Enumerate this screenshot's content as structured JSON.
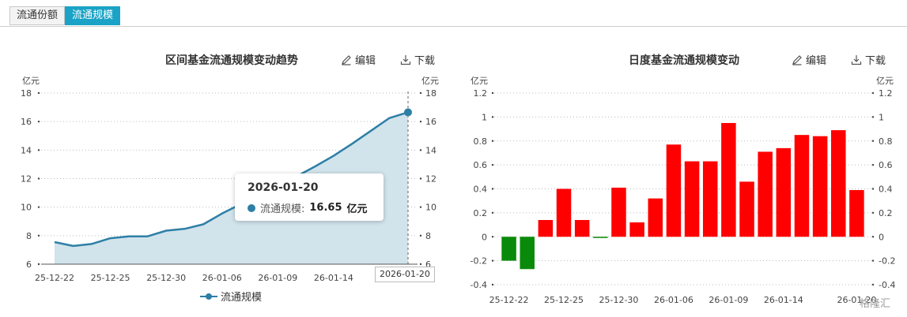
{
  "tabs": [
    {
      "label": "流通份额",
      "active": false
    },
    {
      "label": "流通规模",
      "active": true
    }
  ],
  "toolbar": {
    "edit_label": "编辑",
    "download_label": "下载"
  },
  "colors": {
    "accent": "#1aa3c6",
    "line": "#2e7fa6",
    "area": "#cfe2ea",
    "positive": "#ff0000",
    "negative": "#0a8a0a"
  },
  "watermark": "格隆汇",
  "tooltip": {
    "date": "2026-01-20",
    "series": "流通规模:",
    "value": "16.65",
    "unit": "亿元"
  },
  "chart_data": [
    {
      "type": "area",
      "title": "区间基金流通规模变动趋势",
      "unit_left": "亿元",
      "unit_right": "亿元",
      "ylim": [
        6,
        18
      ],
      "yticks": [
        6,
        8,
        10,
        12,
        14,
        16,
        18
      ],
      "xtick_labels": [
        "25-12-22",
        "25-12-25",
        "25-12-30",
        "26-01-06",
        "26-01-09",
        "26-01-14",
        "26-01-20"
      ],
      "x": [
        "25-12-22",
        "25-12-23",
        "25-12-24",
        "25-12-25",
        "25-12-26",
        "25-12-29",
        "25-12-30",
        "25-12-31",
        "26-01-05",
        "26-01-06",
        "26-01-07",
        "26-01-08",
        "26-01-09",
        "26-01-12",
        "26-01-13",
        "26-01-14",
        "26-01-15",
        "26-01-16",
        "26-01-19",
        "26-01-20"
      ],
      "series": [
        {
          "name": "流通规模",
          "values": [
            7.55,
            7.28,
            7.42,
            7.82,
            7.95,
            7.95,
            8.35,
            8.48,
            8.8,
            9.55,
            10.2,
            10.85,
            11.35,
            12.15,
            12.85,
            13.6,
            14.45,
            15.35,
            16.25,
            16.65
          ]
        }
      ],
      "grid": true,
      "legend": "bottom"
    },
    {
      "type": "bar",
      "title": "日度基金流通规模变动",
      "unit_left": "亿元",
      "unit_right": "亿元",
      "ylim": [
        -0.4,
        1.2
      ],
      "yticks": [
        -0.4,
        -0.2,
        0,
        0.2,
        0.4,
        0.6,
        0.8,
        1,
        1.2
      ],
      "xtick_labels": [
        "25-12-22",
        "25-12-25",
        "25-12-30",
        "26-01-06",
        "26-01-09",
        "26-01-14",
        "26-01-20"
      ],
      "categories": [
        "25-12-22",
        "25-12-23",
        "25-12-24",
        "25-12-25",
        "25-12-26",
        "25-12-29",
        "25-12-30",
        "25-12-31",
        "26-01-05",
        "26-01-06",
        "26-01-07",
        "26-01-08",
        "26-01-09",
        "26-01-12",
        "26-01-13",
        "26-01-14",
        "26-01-15",
        "26-01-16",
        "26-01-19",
        "26-01-20"
      ],
      "values": [
        -0.2,
        -0.27,
        0.14,
        0.4,
        0.14,
        -0.01,
        0.41,
        0.12,
        0.32,
        0.77,
        0.63,
        0.63,
        0.95,
        0.46,
        0.71,
        0.74,
        0.85,
        0.84,
        0.89,
        0.39
      ],
      "grid": true
    }
  ]
}
